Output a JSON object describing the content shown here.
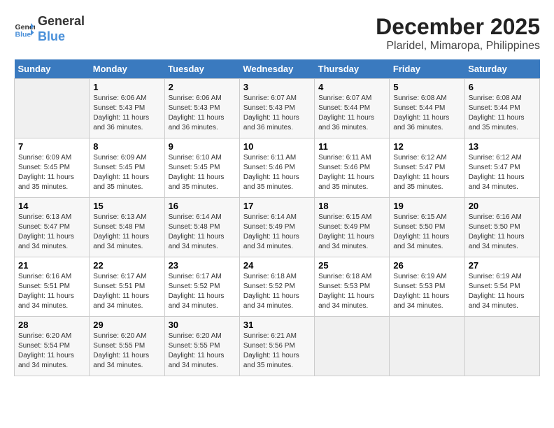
{
  "header": {
    "logo_general": "General",
    "logo_blue": "Blue",
    "main_title": "December 2025",
    "subtitle": "Plaridel, Mimaropa, Philippines"
  },
  "days_of_week": [
    "Sunday",
    "Monday",
    "Tuesday",
    "Wednesday",
    "Thursday",
    "Friday",
    "Saturday"
  ],
  "weeks": [
    [
      {
        "num": "",
        "info": ""
      },
      {
        "num": "1",
        "info": "Sunrise: 6:06 AM\nSunset: 5:43 PM\nDaylight: 11 hours\nand 36 minutes."
      },
      {
        "num": "2",
        "info": "Sunrise: 6:06 AM\nSunset: 5:43 PM\nDaylight: 11 hours\nand 36 minutes."
      },
      {
        "num": "3",
        "info": "Sunrise: 6:07 AM\nSunset: 5:43 PM\nDaylight: 11 hours\nand 36 minutes."
      },
      {
        "num": "4",
        "info": "Sunrise: 6:07 AM\nSunset: 5:44 PM\nDaylight: 11 hours\nand 36 minutes."
      },
      {
        "num": "5",
        "info": "Sunrise: 6:08 AM\nSunset: 5:44 PM\nDaylight: 11 hours\nand 36 minutes."
      },
      {
        "num": "6",
        "info": "Sunrise: 6:08 AM\nSunset: 5:44 PM\nDaylight: 11 hours\nand 35 minutes."
      }
    ],
    [
      {
        "num": "7",
        "info": "Sunrise: 6:09 AM\nSunset: 5:45 PM\nDaylight: 11 hours\nand 35 minutes."
      },
      {
        "num": "8",
        "info": "Sunrise: 6:09 AM\nSunset: 5:45 PM\nDaylight: 11 hours\nand 35 minutes."
      },
      {
        "num": "9",
        "info": "Sunrise: 6:10 AM\nSunset: 5:45 PM\nDaylight: 11 hours\nand 35 minutes."
      },
      {
        "num": "10",
        "info": "Sunrise: 6:11 AM\nSunset: 5:46 PM\nDaylight: 11 hours\nand 35 minutes."
      },
      {
        "num": "11",
        "info": "Sunrise: 6:11 AM\nSunset: 5:46 PM\nDaylight: 11 hours\nand 35 minutes."
      },
      {
        "num": "12",
        "info": "Sunrise: 6:12 AM\nSunset: 5:47 PM\nDaylight: 11 hours\nand 35 minutes."
      },
      {
        "num": "13",
        "info": "Sunrise: 6:12 AM\nSunset: 5:47 PM\nDaylight: 11 hours\nand 34 minutes."
      }
    ],
    [
      {
        "num": "14",
        "info": "Sunrise: 6:13 AM\nSunset: 5:47 PM\nDaylight: 11 hours\nand 34 minutes."
      },
      {
        "num": "15",
        "info": "Sunrise: 6:13 AM\nSunset: 5:48 PM\nDaylight: 11 hours\nand 34 minutes."
      },
      {
        "num": "16",
        "info": "Sunrise: 6:14 AM\nSunset: 5:48 PM\nDaylight: 11 hours\nand 34 minutes."
      },
      {
        "num": "17",
        "info": "Sunrise: 6:14 AM\nSunset: 5:49 PM\nDaylight: 11 hours\nand 34 minutes."
      },
      {
        "num": "18",
        "info": "Sunrise: 6:15 AM\nSunset: 5:49 PM\nDaylight: 11 hours\nand 34 minutes."
      },
      {
        "num": "19",
        "info": "Sunrise: 6:15 AM\nSunset: 5:50 PM\nDaylight: 11 hours\nand 34 minutes."
      },
      {
        "num": "20",
        "info": "Sunrise: 6:16 AM\nSunset: 5:50 PM\nDaylight: 11 hours\nand 34 minutes."
      }
    ],
    [
      {
        "num": "21",
        "info": "Sunrise: 6:16 AM\nSunset: 5:51 PM\nDaylight: 11 hours\nand 34 minutes."
      },
      {
        "num": "22",
        "info": "Sunrise: 6:17 AM\nSunset: 5:51 PM\nDaylight: 11 hours\nand 34 minutes."
      },
      {
        "num": "23",
        "info": "Sunrise: 6:17 AM\nSunset: 5:52 PM\nDaylight: 11 hours\nand 34 minutes."
      },
      {
        "num": "24",
        "info": "Sunrise: 6:18 AM\nSunset: 5:52 PM\nDaylight: 11 hours\nand 34 minutes."
      },
      {
        "num": "25",
        "info": "Sunrise: 6:18 AM\nSunset: 5:53 PM\nDaylight: 11 hours\nand 34 minutes."
      },
      {
        "num": "26",
        "info": "Sunrise: 6:19 AM\nSunset: 5:53 PM\nDaylight: 11 hours\nand 34 minutes."
      },
      {
        "num": "27",
        "info": "Sunrise: 6:19 AM\nSunset: 5:54 PM\nDaylight: 11 hours\nand 34 minutes."
      }
    ],
    [
      {
        "num": "28",
        "info": "Sunrise: 6:20 AM\nSunset: 5:54 PM\nDaylight: 11 hours\nand 34 minutes."
      },
      {
        "num": "29",
        "info": "Sunrise: 6:20 AM\nSunset: 5:55 PM\nDaylight: 11 hours\nand 34 minutes."
      },
      {
        "num": "30",
        "info": "Sunrise: 6:20 AM\nSunset: 5:55 PM\nDaylight: 11 hours\nand 34 minutes."
      },
      {
        "num": "31",
        "info": "Sunrise: 6:21 AM\nSunset: 5:56 PM\nDaylight: 11 hours\nand 35 minutes."
      },
      {
        "num": "",
        "info": ""
      },
      {
        "num": "",
        "info": ""
      },
      {
        "num": "",
        "info": ""
      }
    ]
  ]
}
